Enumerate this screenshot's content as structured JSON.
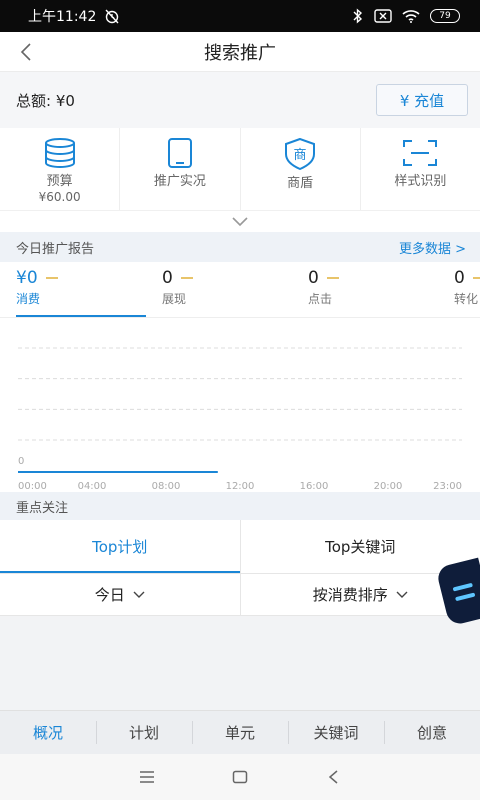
{
  "status": {
    "time": "上午11:42",
    "battery": "79"
  },
  "header": {
    "title": "搜索推广"
  },
  "account": {
    "total_label": "总额: ¥0",
    "recharge_label": "¥ 充值"
  },
  "tiles": [
    {
      "label": "预算",
      "sub": "¥60.00",
      "icon": "database-icon"
    },
    {
      "label": "推广实况",
      "sub": "",
      "icon": "tablet-icon"
    },
    {
      "label": "商盾",
      "sub": "",
      "icon": "shield-icon"
    },
    {
      "label": "样式识别",
      "sub": "",
      "icon": "scan-icon"
    }
  ],
  "report": {
    "title": "今日推广报告",
    "more": "更多数据 >",
    "metrics": [
      {
        "value": "¥0",
        "label": "消费"
      },
      {
        "value": "0",
        "label": "展现"
      },
      {
        "value": "0",
        "label": "点击"
      },
      {
        "value": "0",
        "label": "转化"
      }
    ]
  },
  "chart_data": {
    "type": "line",
    "x": [
      "00:00",
      "04:00",
      "08:00",
      "12:00",
      "16:00",
      "20:00",
      "23:00"
    ],
    "series": [
      {
        "values": [
          0,
          0,
          0,
          0
        ]
      }
    ],
    "y_tick_labels": [
      "0"
    ],
    "title": "",
    "xlabel": "",
    "ylabel": "",
    "grid": true,
    "colors": {
      "line": "#1a86d6",
      "grid": "#dcdcdc",
      "axis_text": "#aaaaaa"
    }
  },
  "focus": {
    "title": "重点关注",
    "tabs": [
      {
        "label": "Top计划"
      },
      {
        "label": "Top关键词"
      }
    ],
    "filters": [
      {
        "label": "今日"
      },
      {
        "label": "按消费排序"
      }
    ]
  },
  "bottom_tabs": [
    "概况",
    "计划",
    "单元",
    "关键词",
    "创意"
  ],
  "colors": {
    "accent": "#1a86d6",
    "metric_dash": "#e8c46a"
  }
}
